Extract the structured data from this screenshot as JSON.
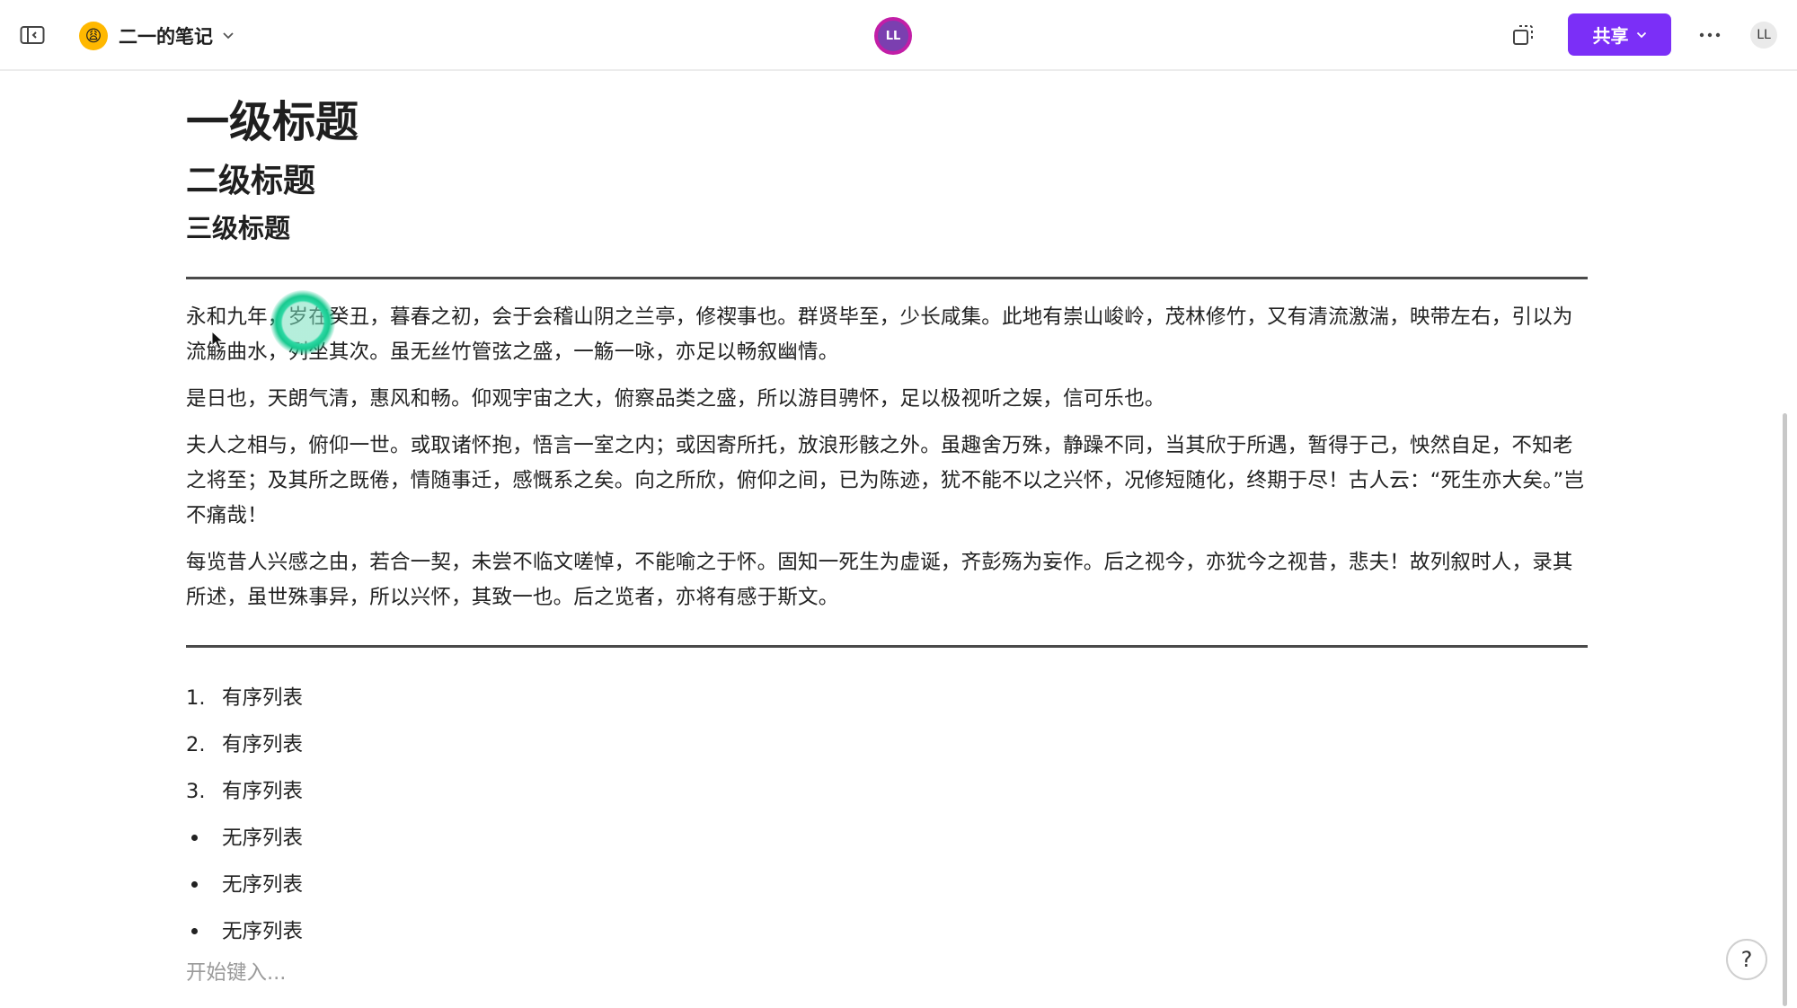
{
  "header": {
    "notebook_emoji": "😩",
    "notebook_title": "二一的笔记",
    "presence_initials": "LL",
    "share_label": "共享",
    "user_initials": "LL"
  },
  "document": {
    "h1": "一级标题",
    "h2": "二级标题",
    "h3": "三级标题",
    "paragraphs": [
      "永和九年，岁在癸丑，暮春之初，会于会稽山阴之兰亭，修禊事也。群贤毕至，少长咸集。此地有崇山峻岭，茂林修竹，又有清流激湍，映带左右，引以为流觞曲水，列坐其次。虽无丝竹管弦之盛，一觞一咏，亦足以畅叙幽情。",
      "是日也，天朗气清，惠风和畅。仰观宇宙之大，俯察品类之盛，所以游目骋怀，足以极视听之娱，信可乐也。",
      "夫人之相与，俯仰一世。或取诸怀抱，悟言一室之内；或因寄所托，放浪形骸之外。虽趣舍万殊，静躁不同，当其欣于所遇，暂得于己，怏然自足，不知老之将至；及其所之既倦，情随事迁，感慨系之矣。向之所欣，俯仰之间，已为陈迹，犹不能不以之兴怀，况修短随化，终期于尽！古人云：“死生亦大矣。”岂不痛哉！",
      "每览昔人兴感之由，若合一契，未尝不临文嗟悼，不能喻之于怀。固知一死生为虚诞，齐彭殇为妄作。后之视今，亦犹今之视昔，悲夫！故列叙时人，录其所述，虽世殊事异，所以兴怀，其致一也。后之览者，亦将有感于斯文。"
    ],
    "ordered_list": [
      {
        "marker": "1.",
        "text": "有序列表"
      },
      {
        "marker": "2.",
        "text": "有序列表"
      },
      {
        "marker": "3.",
        "text": "有序列表"
      }
    ],
    "unordered_list": [
      {
        "text": "无序列表"
      },
      {
        "text": "无序列表"
      },
      {
        "text": "无序列表"
      }
    ],
    "placeholder": "开始键入..."
  },
  "help_label": "?",
  "colors": {
    "accent": "#7b2ff7",
    "presence_ring": "#c21ea7",
    "divider": "#4a4a4a",
    "placeholder": "#9a9a9a"
  }
}
